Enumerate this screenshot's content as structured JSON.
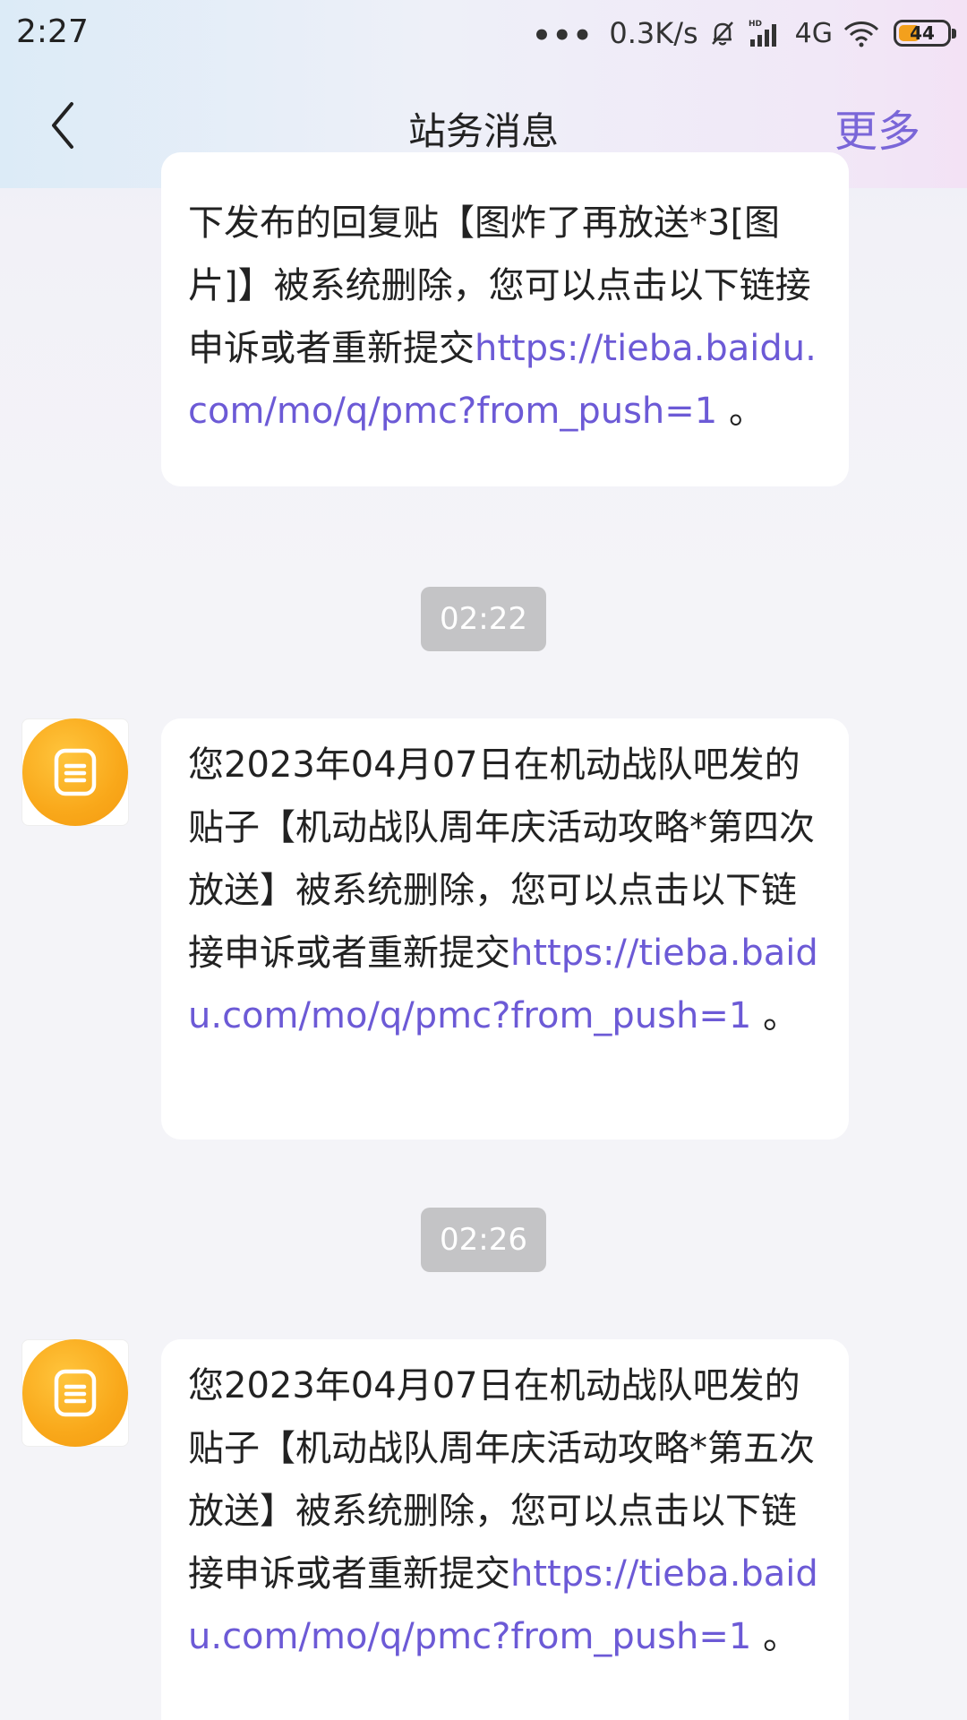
{
  "status_bar": {
    "time": "2:27",
    "dots": "•••",
    "speed": "0.3K/s",
    "network": "4G",
    "battery": "44",
    "battery_level": 0.44
  },
  "nav": {
    "title": "站务消息",
    "more": "更多"
  },
  "messages": [
    {
      "text": "下发布的回复贴【图炸了再放送*3[图片]】被系统删除，您可以点击以下链接申诉或者重新提交",
      "link": "https://tieba.baidu.com/mo/q/pmc?from_push=1",
      "end": " 。"
    },
    {
      "time": "02:22",
      "text": "您2023年04月07日在机动战队吧发的贴子【机动战队周年庆活动攻略*第四次放送】被系统删除，您可以点击以下链接申诉或者重新提交",
      "link": "https://tieba.baidu.com/mo/q/pmc?from_push=1",
      "end": " 。"
    },
    {
      "time": "02:26",
      "text": "您2023年04月07日在机动战队吧发的贴子【机动战队周年庆活动攻略*第五次放送】被系统删除，您可以点击以下链接申诉或者重新提交",
      "link": "https://tieba.baidu.com/mo/q/pmc?from_push=1",
      "end": " 。"
    }
  ],
  "colors": {
    "accent": "#7a66d8",
    "link": "#6c5ad6",
    "avatar": "#f9a81a",
    "timestamp_bg": "#c4c4c6"
  }
}
